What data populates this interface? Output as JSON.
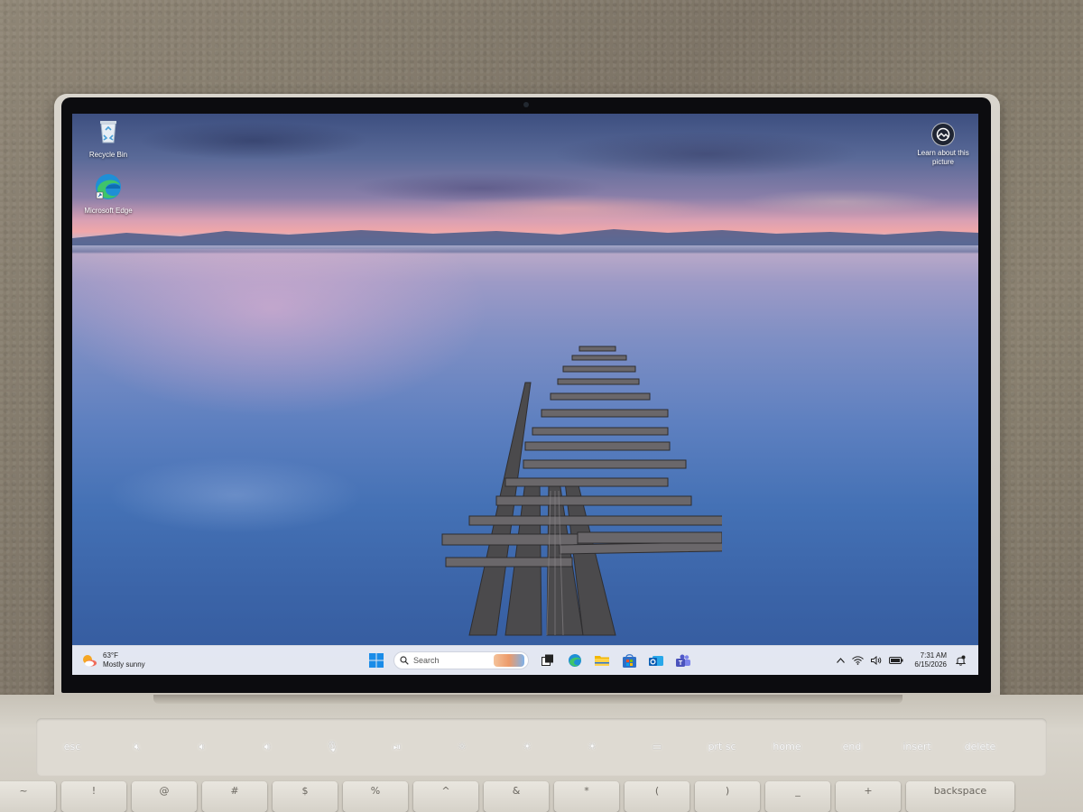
{
  "desktop": {
    "icons": [
      {
        "label": "Recycle Bin",
        "icon": "recycle-bin-icon"
      },
      {
        "label": "Microsoft Edge",
        "icon": "edge-icon"
      }
    ],
    "spotlight": {
      "label": "Learn about this picture",
      "icon": "camera-circle-icon"
    }
  },
  "taskbar": {
    "weather": {
      "temp": "63°F",
      "condition": "Mostly sunny",
      "icon": "weather-sun-cloud-icon"
    },
    "search": {
      "placeholder": "Search"
    },
    "pinned": [
      "windows-start-icon",
      "task-view-icon",
      "edge-icon",
      "file-explorer-icon",
      "microsoft-store-icon",
      "outlook-icon",
      "teams-icon"
    ],
    "tray": {
      "icons": [
        "chevron-up-icon",
        "wifi-icon",
        "volume-icon",
        "battery-icon"
      ],
      "time": "7:31 AM",
      "date": "6/15/2026",
      "notification_icon": "notification-bell-icon"
    }
  },
  "keyboard": {
    "function_row": [
      "esc",
      "🔇︎",
      "🔉︎",
      "🔊︎",
      "🎙︎",
      "⏯︎",
      "☼",
      "☀︎",
      "☀︎",
      "▭",
      "prt sc",
      "home",
      "end",
      "insert",
      "delete"
    ],
    "number_row": [
      "~",
      "!",
      "@",
      "#",
      "$",
      "%",
      "^",
      "&",
      "*",
      "(",
      ")",
      "_",
      "+",
      "backspace"
    ]
  }
}
